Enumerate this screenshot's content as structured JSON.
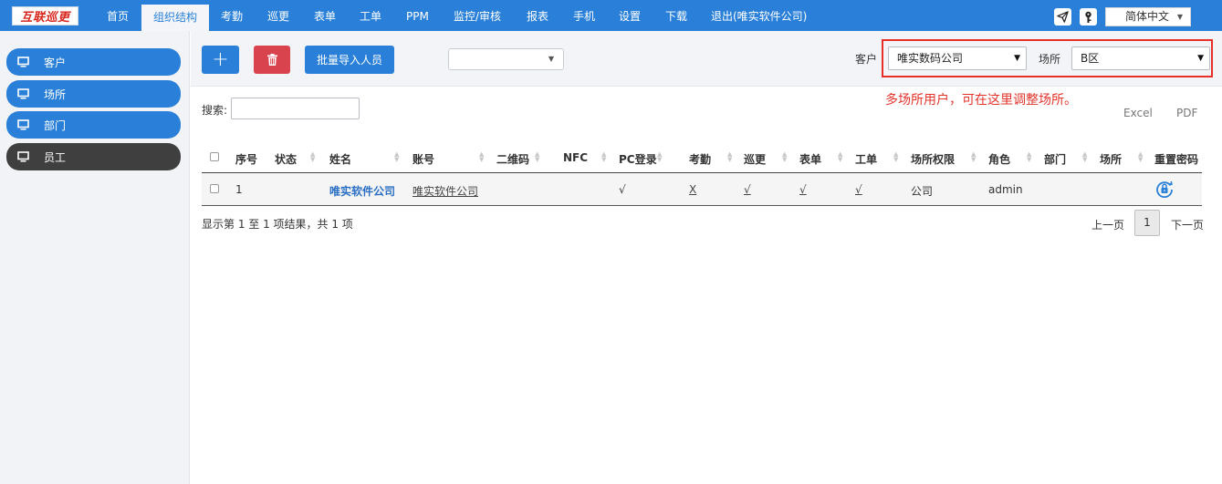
{
  "logo_text": "互联巡更",
  "nav": [
    "首页",
    "组织结构",
    "考勤",
    "巡更",
    "表单",
    "工单",
    "PPM",
    "监控/审核",
    "报表",
    "手机",
    "设置",
    "下载",
    "退出(唯实软件公司)"
  ],
  "nav_active": "组织结构",
  "top_icons": [
    "paper-plane-icon",
    "key-icon"
  ],
  "language": "简体中文",
  "sidebar": [
    {
      "label": "客户",
      "icon": "monitor-icon"
    },
    {
      "label": "场所",
      "icon": "monitor-icon"
    },
    {
      "label": "部门",
      "icon": "monitor-icon"
    },
    {
      "label": "员工",
      "icon": "monitor-icon",
      "active": true
    }
  ],
  "toolbar": {
    "add_label": "+",
    "import_label": "批量导入人员",
    "dropdown_value": ""
  },
  "filters": {
    "customer_label": "客户",
    "customer_value": "唯实数码公司",
    "site_label": "场所",
    "site_value": "B区"
  },
  "annotation": "多场所用户，可在这里调整场所。",
  "search": {
    "label": "搜索:",
    "value": ""
  },
  "export": {
    "excel": "Excel",
    "pdf": "PDF"
  },
  "table": {
    "columns": [
      "序号",
      "状态",
      "姓名",
      "账号",
      "二维码",
      "NFC",
      "PC登录",
      "考勤",
      "巡更",
      "表单",
      "工单",
      "场所权限",
      "角色",
      "部门",
      "场所",
      "重置密码"
    ],
    "rows": [
      {
        "no": "1",
        "status": "",
        "name": "唯实软件公司",
        "account": "唯实软件公司",
        "qr": "",
        "nfc": "",
        "pc_login": "√",
        "attendance": "X",
        "patrol": "√",
        "form": "√",
        "workorder": "√",
        "site_perm": "公司",
        "role": "admin",
        "dept": "",
        "site": ""
      }
    ]
  },
  "info_text": "显示第 1 至 1 项结果，共 1 项",
  "pager": {
    "prev": "上一页",
    "page": "1",
    "next": "下一页"
  },
  "colors": {
    "primary": "#2a80d8",
    "danger": "#d9434e",
    "annotation": "#e3332a"
  }
}
